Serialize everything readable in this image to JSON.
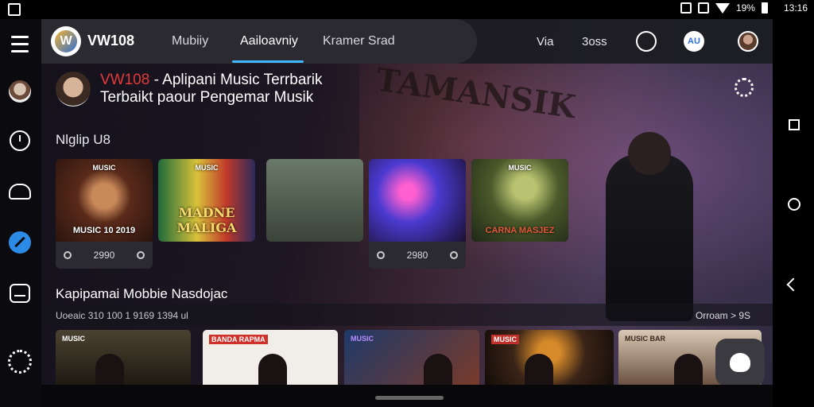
{
  "status_bar": {
    "battery": "19%",
    "time": "13:16"
  },
  "header": {
    "app_title": "VW108",
    "logo_letter": "W",
    "tabs": [
      {
        "label": "Mubiiy"
      },
      {
        "label": "Aailoavniy"
      },
      {
        "label": "Kramer Srad"
      }
    ],
    "link_via": "Via",
    "link_bess": "3oss",
    "badge_text": "AU"
  },
  "hero": {
    "title_red": "VW108",
    "title_line1_rest": " - Aplipani Music Terrbarik",
    "title_line2": "Terbaikt paour Pengemar Musik",
    "art_text": "TAMANSIK"
  },
  "section1": {
    "title": "Nlglip U8",
    "cards": [
      {
        "caption": "MUSIC 10 2019",
        "top_label": "MUSIC",
        "count": "2990",
        "bg": "#5a2a1a"
      },
      {
        "caption": "MADNE MALIGA",
        "top_label": "MUSIC",
        "count": "",
        "bg": "#2c4a3a"
      },
      {
        "caption": "",
        "top_label": "",
        "count": "",
        "bg": "#4d5a4a"
      },
      {
        "caption": "",
        "top_label": "",
        "count": "2980",
        "bg": "#3b2a6e"
      },
      {
        "caption": "CARNA MASJEZ",
        "top_label": "MUSIC",
        "count": "",
        "bg": "#3a4a2a"
      }
    ]
  },
  "section2": {
    "title": "Kapipamai Mobbie Nasdojac",
    "subtitle": "Uoeaic 310 100 1 9169 1394 ul",
    "more": "Orroam > 9S",
    "cards": [
      {
        "tag": "MUSIC",
        "bg": "#3a3324"
      },
      {
        "tag": "BANDA RAPMA",
        "bg": "#e9e6e2"
      },
      {
        "tag": "MUSIC",
        "bg": "#2a3b52"
      },
      {
        "tag": "MUSIC",
        "bg": "#3a2418"
      },
      {
        "tag": "MUSIC BAR",
        "bg": "#c9b9a8"
      }
    ]
  }
}
